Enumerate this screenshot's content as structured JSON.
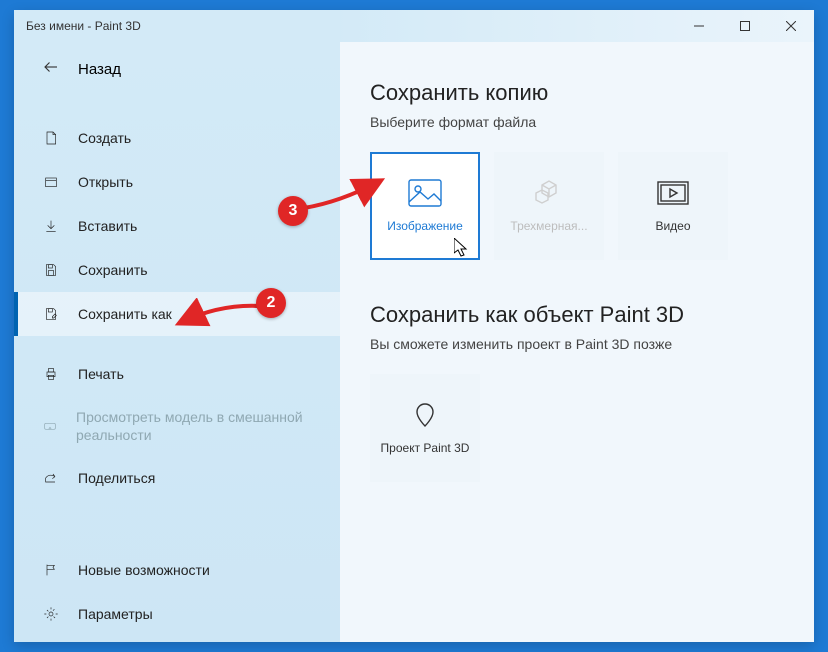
{
  "titlebar": {
    "title": "Без имени - Paint 3D"
  },
  "sidebar": {
    "back_label": "Назад",
    "items": [
      {
        "label": "Создать",
        "icon": "document-icon"
      },
      {
        "label": "Открыть",
        "icon": "folder-icon"
      },
      {
        "label": "Вставить",
        "icon": "download-icon"
      },
      {
        "label": "Сохранить",
        "icon": "save-icon"
      },
      {
        "label": "Сохранить как",
        "icon": "save-as-icon",
        "selected": true
      },
      {
        "label": "Печать",
        "icon": "print-icon"
      },
      {
        "label": "Просмотреть модель в смешанной реальности",
        "icon": "vr-icon",
        "disabled": true
      },
      {
        "label": "Поделиться",
        "icon": "share-icon"
      }
    ],
    "bottom": [
      {
        "label": "Новые возможности",
        "icon": "flag-icon"
      },
      {
        "label": "Параметры",
        "icon": "gear-icon"
      }
    ]
  },
  "content": {
    "section1": {
      "title": "Сохранить копию",
      "subtitle": "Выберите формат файла",
      "cards": [
        {
          "label": "Изображение",
          "icon": "image-icon",
          "selected": true
        },
        {
          "label": "Трехмерная...",
          "icon": "3d-icon",
          "disabled": true
        },
        {
          "label": "Видео",
          "icon": "video-icon"
        }
      ]
    },
    "section2": {
      "title": "Сохранить как объект Paint 3D",
      "subtitle": "Вы сможете изменить проект в Paint 3D позже",
      "cards": [
        {
          "label": "Проект Paint 3D",
          "icon": "pin-icon"
        }
      ]
    }
  },
  "annotations": {
    "badge2": "2",
    "badge3": "3"
  }
}
